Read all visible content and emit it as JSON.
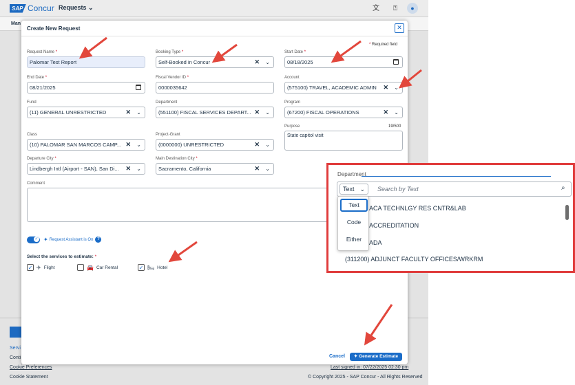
{
  "topbar": {
    "logo_sap": "SAP",
    "logo_concur": "Concur",
    "menu_requests": "Requests",
    "translate_icon": "translate-icon",
    "help_icon": "help-icon",
    "user_icon": "user-icon"
  },
  "subnav": {
    "label": "Man"
  },
  "footer": {
    "service_text": "Servi",
    "conti_text": "Conti",
    "cookie_preferences": "Cookie Preferences",
    "cookie_statement": "Cookie Statement",
    "last_signed_in": "Last signed in: 07/22/2025 02:30 pm",
    "copyright": "© Copyright 2025 - SAP Concur - All Rights Reserved"
  },
  "modal": {
    "title": "Create New Request",
    "required_note": "Required field",
    "fields": {
      "request_name": {
        "label": "Request Name",
        "value": "Palomar Test Report"
      },
      "booking_type": {
        "label": "Booking Type",
        "value": "Self-Booked in Concur"
      },
      "start_date": {
        "label": "Start Date",
        "value": "08/18/2025"
      },
      "end_date": {
        "label": "End Date",
        "value": "08/21/2025"
      },
      "fiscal_vendor": {
        "label": "Fiscal Vendor ID",
        "value": "0000035642"
      },
      "account": {
        "label": "Account",
        "value": "(575100) TRAVEL, ACADEMIC ADMIN"
      },
      "fund": {
        "label": "Fund",
        "value": "(11) GENERAL UNRESTRICTED"
      },
      "department": {
        "label": "Department",
        "value": "(551100) FISCAL SERVICES DEPART..."
      },
      "program": {
        "label": "Program",
        "value": "(67200) FISCAL OPERATIONS"
      },
      "class": {
        "label": "Class",
        "value": "(10) PALOMAR SAN MARCOS CAMP..."
      },
      "project_grant": {
        "label": "Project-Grant",
        "value": "(0000000) UNRESTRICTED"
      },
      "purpose": {
        "label": "Purpose",
        "value": "State capitol visit",
        "count": "19/500"
      },
      "departure_city": {
        "label": "Departure City",
        "value": "Lindbergh Intl (Airport - SAN), San Di..."
      },
      "destination_city": {
        "label": "Main Destination City",
        "value": "Sacramento, California"
      },
      "comment": {
        "label": "Comment",
        "value": ""
      }
    },
    "assistant_label": "Request Assistant is On",
    "services_title": "Select the services to estimate:",
    "services": [
      {
        "label": "Flight",
        "checked": true
      },
      {
        "label": "Car Rental",
        "checked": false
      },
      {
        "label": "Hotel",
        "checked": true
      }
    ],
    "cancel_label": "Cancel",
    "generate_label": "Generate Estimate"
  },
  "callout": {
    "label": "Department",
    "mode_value": "Text",
    "search_placeholder": "Search by Text",
    "mode_options": [
      "Text",
      "Code",
      "Either"
    ],
    "items": [
      "ACA TECHNLGY RES CNTR&LAB",
      "ACCREDITATION",
      "ADA",
      "(311200) ADJUNCT FACULTY OFFICES/WRKRM"
    ],
    "border_color": "#e03c3c"
  },
  "colors": {
    "accent": "#1a6cc8",
    "arrow": "#e2473c",
    "required": "#d0021b"
  }
}
